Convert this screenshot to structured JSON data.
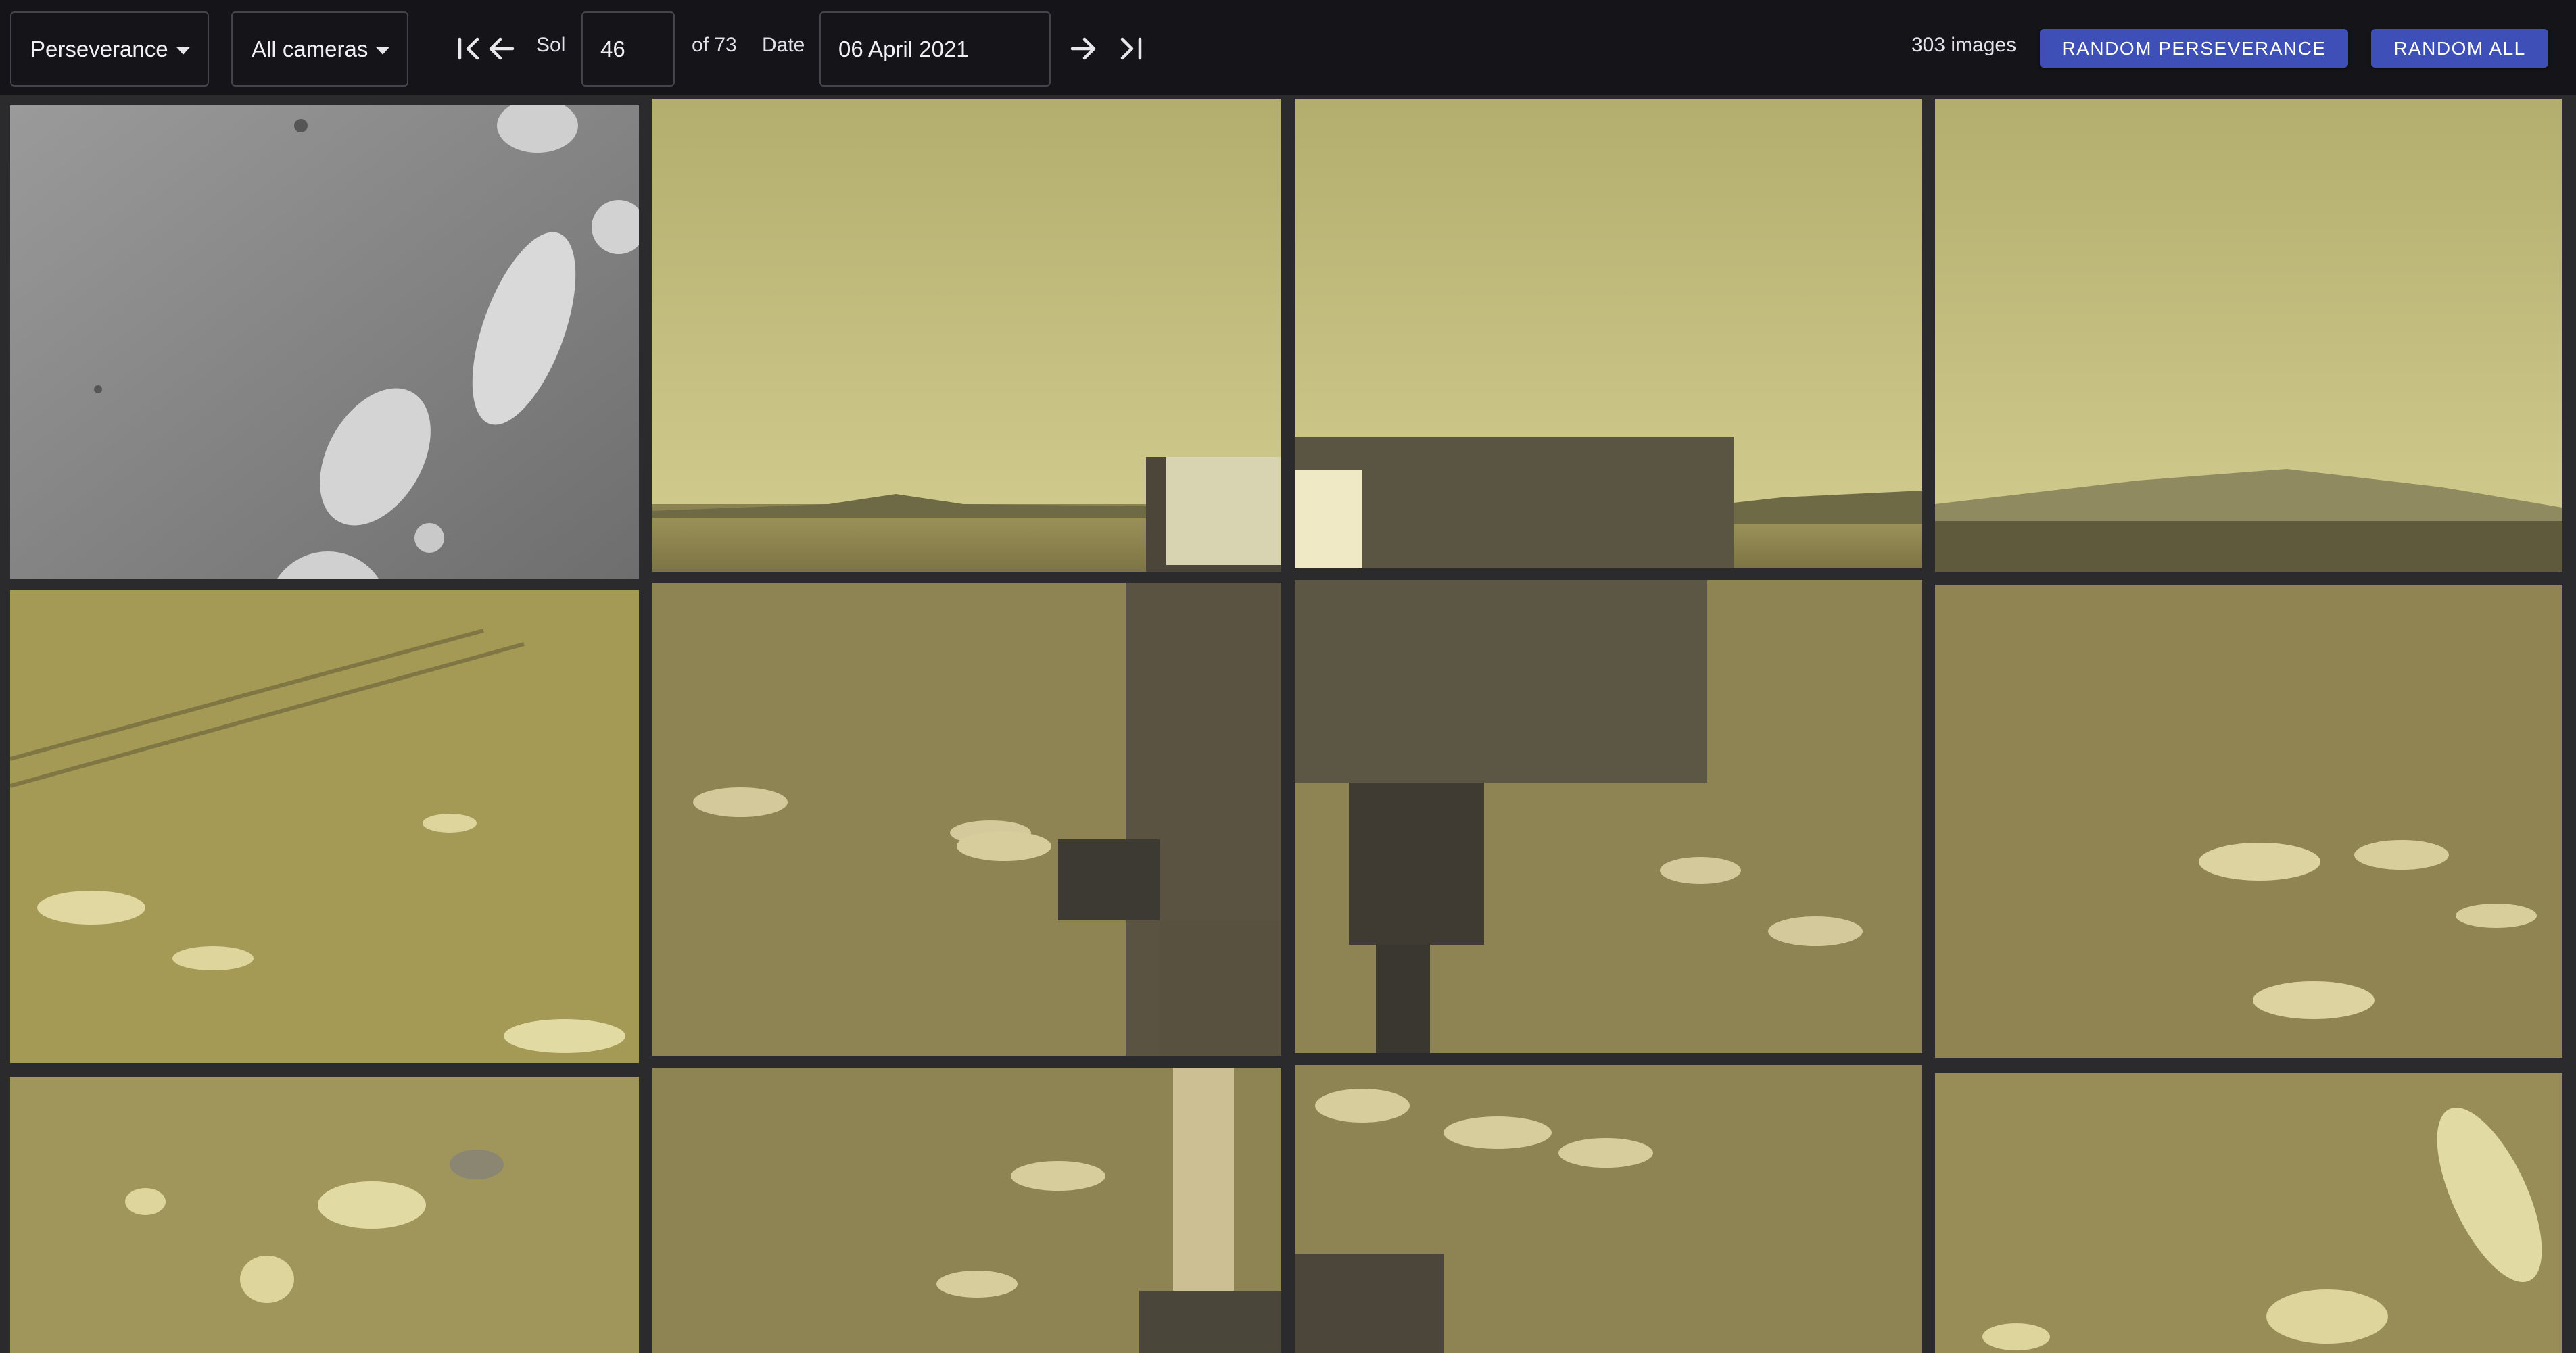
{
  "toolbar": {
    "rover": {
      "selected": "Perseverance"
    },
    "camera": {
      "selected": "All cameras"
    },
    "nav": {
      "first_icon": "first-page-icon",
      "prev_icon": "arrow-left-icon",
      "next_icon": "arrow-right-icon",
      "last_icon": "last-page-icon"
    },
    "sol": {
      "label": "Sol",
      "value": "46",
      "of_text": "of 73"
    },
    "date": {
      "label": "Date",
      "value": "06 April 2021"
    },
    "image_count": "303 images",
    "random_perseverance_label": "RANDOM PERSEVERANCE",
    "random_all_label": "RANDOM ALL"
  },
  "colors": {
    "toolbar_bg": "#141419",
    "accent": "#3f4fb8",
    "grid_bg": "#2b2b2e"
  },
  "gallery": {
    "columns": 4,
    "rows": 3,
    "images": [
      {
        "camera": "grayscale",
        "subject": "ground-with-white-rocks"
      },
      {
        "camera": "color",
        "subject": "horizon-with-rover-mast"
      },
      {
        "camera": "color",
        "subject": "horizon-with-rover-mast"
      },
      {
        "camera": "color",
        "subject": "horizon-with-hills"
      },
      {
        "camera": "color",
        "subject": "ground-with-tracks"
      },
      {
        "camera": "color",
        "subject": "ground-with-rover-mast"
      },
      {
        "camera": "color",
        "subject": "ground-with-rover-mast"
      },
      {
        "camera": "color",
        "subject": "ground-with-rocks"
      },
      {
        "camera": "color",
        "subject": "ground-with-rocks"
      },
      {
        "camera": "color",
        "subject": "ground-with-rover-mast"
      },
      {
        "camera": "color",
        "subject": "ground-with-rover-mast"
      },
      {
        "camera": "color",
        "subject": "ground-with-rocks"
      }
    ]
  }
}
